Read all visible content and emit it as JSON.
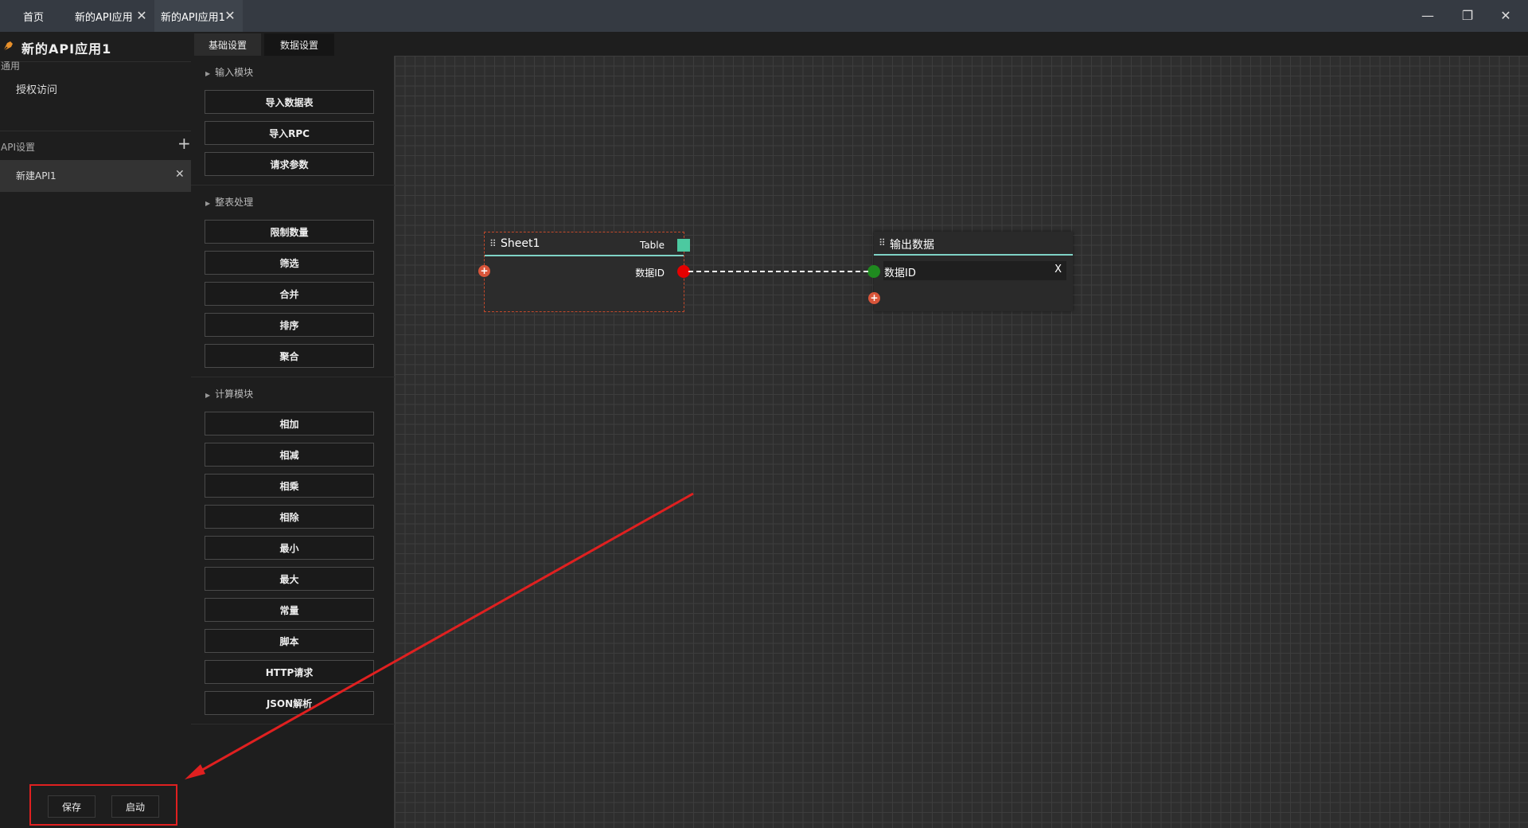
{
  "titlebar": {
    "tabs": [
      {
        "label": "首页"
      },
      {
        "label": "新的API应用"
      },
      {
        "label": "新的API应用1"
      }
    ],
    "close_glyph": "✕",
    "window_controls": {
      "minimize": "—",
      "restore": "❐",
      "close": "✕"
    }
  },
  "sidebar": {
    "app_title": "新的API应用1",
    "general_label": "通用",
    "auth_item": "授权访问",
    "api_settings_label": "API设置",
    "add_glyph": "+",
    "api_items": [
      {
        "label": "新建API1"
      }
    ],
    "remove_glyph": "✕",
    "save_label": "保存",
    "start_label": "启动"
  },
  "panel_tabs": [
    {
      "label": "基础设置"
    },
    {
      "label": "数据设置"
    }
  ],
  "tool_groups": [
    {
      "title": "输入模块",
      "items": [
        "导入数据表",
        "导入RPC",
        "请求参数"
      ]
    },
    {
      "title": "整表处理",
      "items": [
        "限制数量",
        "筛选",
        "合并",
        "排序",
        "聚合"
      ]
    },
    {
      "title": "计算模块",
      "items": [
        "相加",
        "相减",
        "相乘",
        "相除",
        "最小",
        "最大",
        "常量",
        "脚本",
        "HTTP请求",
        "JSON解析"
      ]
    }
  ],
  "nodes": {
    "sheet": {
      "title": "Sheet1",
      "type_label": "Table",
      "field": "数据ID",
      "swatch_color": "#4cc9a0"
    },
    "output": {
      "title": "输出数据",
      "field": "数据ID",
      "remove_label": "X"
    }
  },
  "glyphs": {
    "grip": "⠿",
    "add": "+",
    "triangle": "▶"
  },
  "colors": {
    "accent_teal": "#7fd3c6",
    "port_red": "#e50000",
    "port_green": "#1f8a1f",
    "annotation_red": "#e02020"
  }
}
